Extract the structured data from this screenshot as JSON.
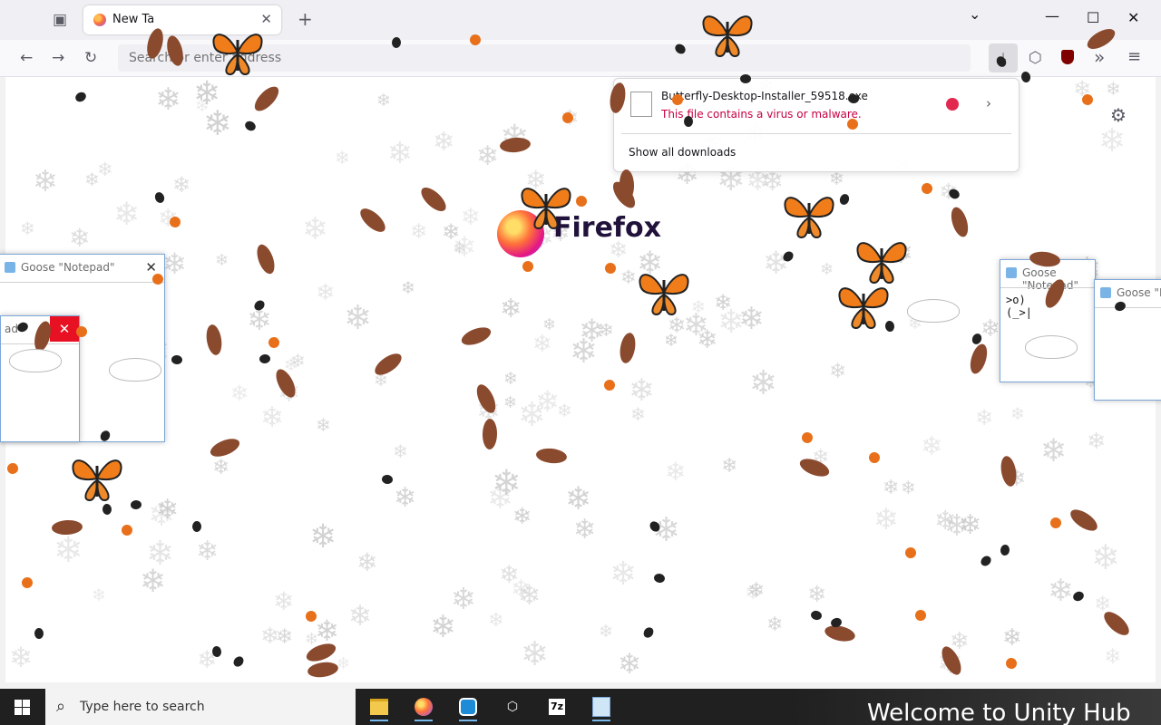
{
  "browser": {
    "tab": {
      "label": "New Ta",
      "close": "✕"
    },
    "new_tab": "+",
    "tab_list": "⌄",
    "window_controls": {
      "minimize": "—",
      "maximize": "☐",
      "close": "✕"
    },
    "nav": {
      "back": "←",
      "forward": "→",
      "reload": "↻"
    },
    "urlbar": {
      "placeholder": "Search or enter address"
    },
    "toolbar": {
      "downloads": "⤓",
      "extensions": "⬡",
      "overflow": "»",
      "menu": "≡"
    }
  },
  "newtab": {
    "logo_text": "Firefox",
    "settings": "⚙"
  },
  "downloads_panel": {
    "file_name": "Butterfly-Desktop-Installer_59518.exe",
    "warning": "This file contains a virus or malware.",
    "show_all": "Show all downloads",
    "more": "›"
  },
  "notepads": [
    {
      "title": "Goose \"Notepad\"",
      "content": ""
    },
    {
      "title": "Goose \"Notepad\"",
      "content": ">o)\n(_>|"
    },
    {
      "title": "Goose \"N",
      "content": ""
    },
    {
      "title": "ad\"",
      "content": ""
    }
  ],
  "taskbar": {
    "search_placeholder": "Type here to search",
    "apps": [
      "file-explorer",
      "firefox",
      "unity-hub",
      "unity",
      "7-zip",
      "notepad"
    ],
    "app_labels": {
      "seven_zip": "7z"
    },
    "unity_banner": "Welcome to Unity Hub"
  },
  "colors": {
    "accent": "#0060df",
    "warning": "#c50042",
    "taskbar": "#202020"
  }
}
